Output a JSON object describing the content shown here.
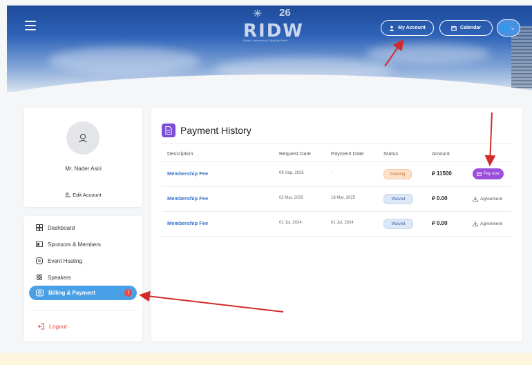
{
  "header": {
    "logo_text": "RIDW",
    "logo_number": "26",
    "logo_tagline": "Riyadh International Disability Week",
    "my_account_label": "My Account",
    "calendar_label": "Calendar"
  },
  "profile": {
    "name": "Mr. Nader Asiri",
    "edit_label": "Edit Account"
  },
  "menu": {
    "items": [
      {
        "label": "Dashboard",
        "icon": "dashboard-icon"
      },
      {
        "label": "Sponsors & Members",
        "icon": "sponsors-icon"
      },
      {
        "label": "Event Hosting",
        "icon": "event-hosting-icon"
      },
      {
        "label": "Speakers",
        "icon": "speakers-icon"
      },
      {
        "label": "Billing & Payment",
        "icon": "billing-icon",
        "active": true,
        "badge": "!"
      }
    ],
    "logout_label": "Logout"
  },
  "payments": {
    "title": "Payment History",
    "columns": [
      "Description",
      "Request Date",
      "Payment Date",
      "Status",
      "Amount"
    ],
    "rows": [
      {
        "description": "Membership Fee",
        "request_date": "09 Sep, 2025",
        "payment_date": "-",
        "status": "Pending",
        "amount": "11500",
        "action": "Pay now"
      },
      {
        "description": "Membership Fee",
        "request_date": "02 Mar, 2025",
        "payment_date": "18 Mar, 2025",
        "status": "Waived",
        "amount": "0.00",
        "action": "Agreement"
      },
      {
        "description": "Membership Fee",
        "request_date": "01 Jul, 2024",
        "payment_date": "01 Jul, 2024",
        "status": "Waived",
        "amount": "0.00",
        "action": "Agreement"
      }
    ],
    "currency_symbol": "⃁"
  },
  "colors": {
    "accent": "#4aa0e6",
    "pay_button": "#9b4ddb",
    "arrow": "#d42a2a"
  }
}
